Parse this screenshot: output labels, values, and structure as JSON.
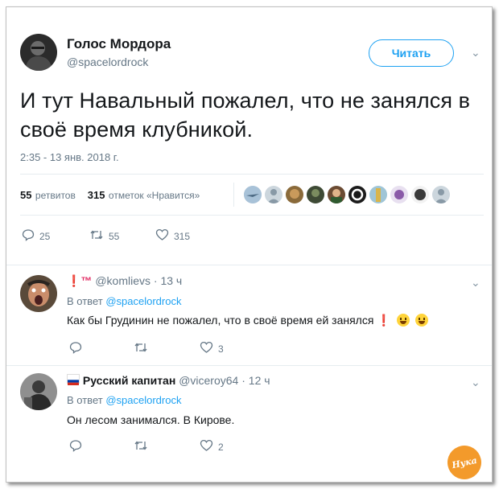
{
  "main_tweet": {
    "author_name": "Голос Мордора",
    "author_handle": "@spacelordrock",
    "follow_label": "Читать",
    "text": "И тут Навальный пожалел, что не занялся в своё время клубникой.",
    "timestamp": "2:35 - 13 янв. 2018 г.",
    "retweets_count": "55",
    "retweets_label": "ретвитов",
    "likes_count": "315",
    "likes_label": "отметок «Нравится»",
    "actions": {
      "replies": "25",
      "retweets": "55",
      "likes": "315"
    }
  },
  "replies": [
    {
      "name_badge": "❗™",
      "handle": "@komlievs",
      "time": "· 13 ч",
      "reply_to_prefix": "В ответ",
      "reply_to_handle": "@spacelordrock",
      "text": "Как бы Грудинин не пожалел, что в своё время ей занялся",
      "text_bang": "❗",
      "actions": {
        "replies": "",
        "retweets": "",
        "likes": "3"
      }
    },
    {
      "name": "Русский капитан",
      "handle": "@viceroy64",
      "time": "· 12 ч",
      "reply_to_prefix": "В ответ",
      "reply_to_handle": "@spacelordrock",
      "text": "Он лесом занимался. В Кирове.",
      "actions": {
        "replies": "",
        "retweets": "",
        "likes": "2"
      }
    }
  ],
  "watermark": {
    "text": "Нука"
  },
  "colors": {
    "accent": "#1da1f2",
    "secondary_text": "#657786",
    "divider": "#e6ecf0"
  }
}
